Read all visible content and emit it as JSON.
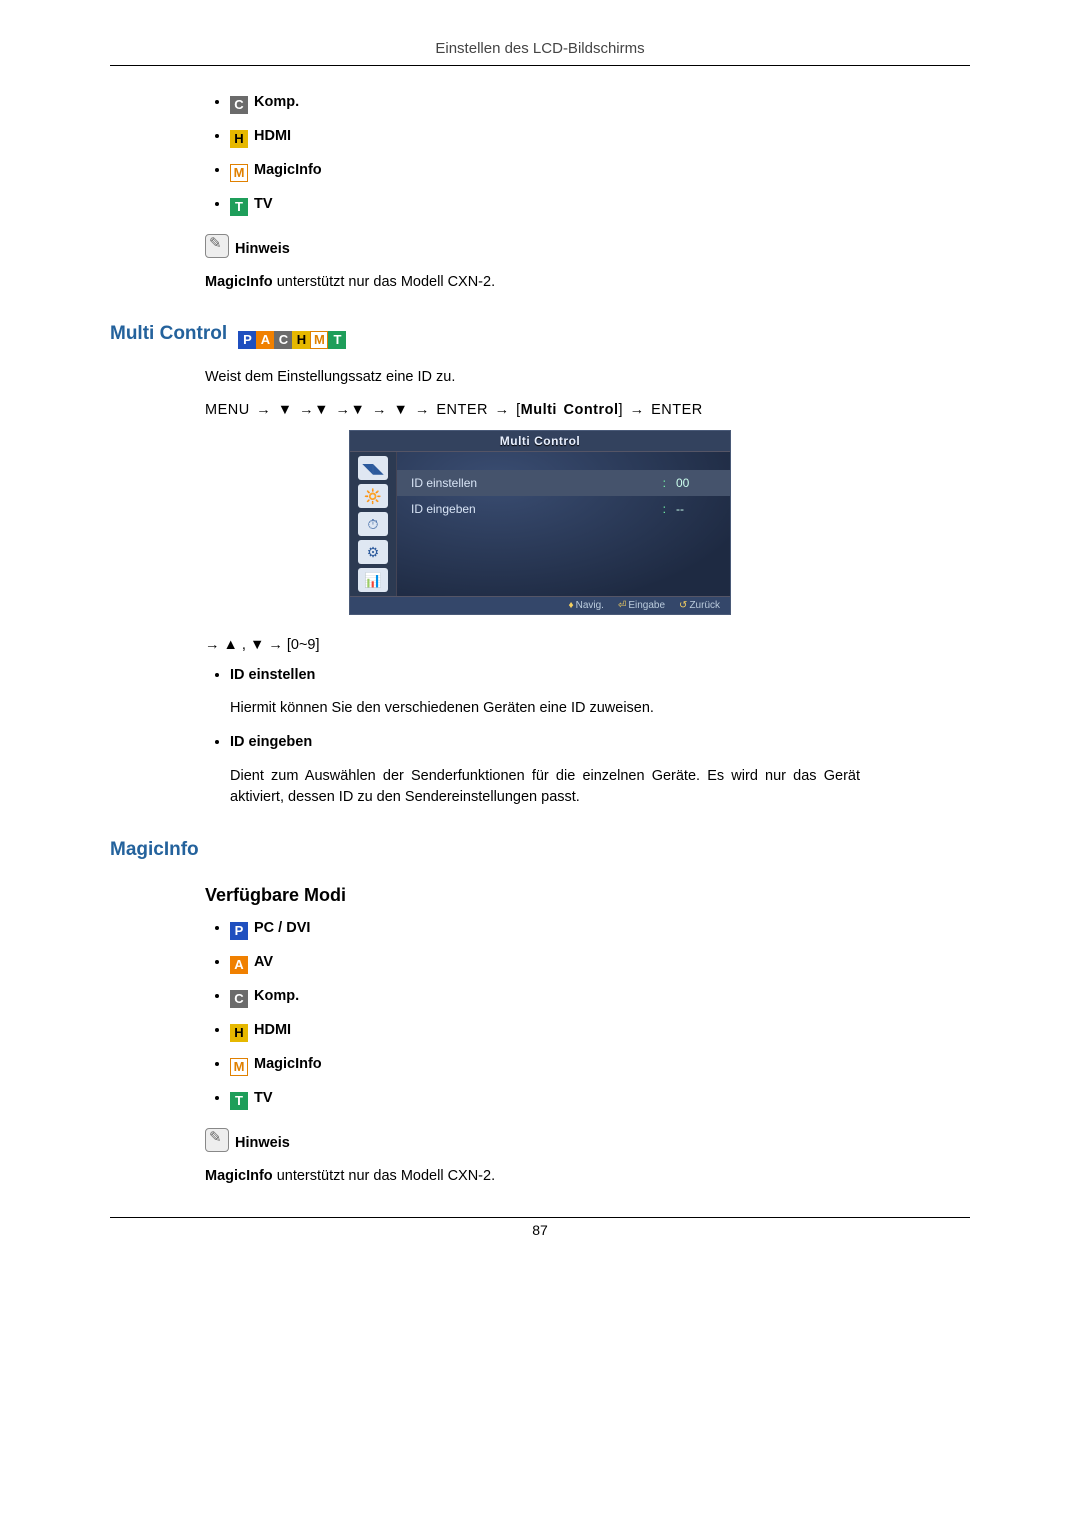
{
  "header": "Einstellen des LCD-Bildschirms",
  "modes_top": {
    "items": [
      {
        "badge": "C",
        "cls": "b-c",
        "label": "Komp."
      },
      {
        "badge": "H",
        "cls": "b-h",
        "label": "HDMI"
      },
      {
        "badge": "M",
        "cls": "b-m",
        "label": "MagicInfo"
      },
      {
        "badge": "T",
        "cls": "b-t",
        "label": "TV"
      }
    ]
  },
  "note_label": "Hinweis",
  "note1": {
    "b": "MagicInfo",
    "rest": " unterstützt nur das Modell CXN-2."
  },
  "multi": {
    "title": "Multi Control",
    "strip": [
      {
        "badge": "P",
        "cls": "b-p"
      },
      {
        "badge": "A",
        "cls": "b-a"
      },
      {
        "badge": "C",
        "cls": "b-c"
      },
      {
        "badge": "H",
        "cls": "b-h"
      },
      {
        "badge": "M",
        "cls": "b-m"
      },
      {
        "badge": "T",
        "cls": "b-t"
      }
    ],
    "intro": "Weist dem Einstellungssatz eine ID zu.",
    "path": {
      "p1": "MENU →",
      "dn": "▼",
      "arr": "→",
      "enter": "ENTER",
      "bracket_open": "[",
      "multi": "Multi Control",
      "bracket_close": "]"
    },
    "osd": {
      "title": "Multi Control",
      "row1": {
        "lbl": "ID einstellen",
        "val": "00"
      },
      "row2": {
        "lbl": "ID eingeben",
        "val": "--"
      },
      "foot": {
        "nav": "Navig.",
        "ent": "Eingabe",
        "back": "Zurück"
      }
    },
    "arrows_line": "→ ▲ , ▼ → [0~9]",
    "opt1": {
      "h": "ID einstellen",
      "p": "Hiermit können Sie den verschiedenen Geräten eine ID zuweisen."
    },
    "opt2": {
      "h": "ID eingeben",
      "p": "Dient zum Auswählen der Senderfunktionen für die einzelnen Geräte. Es wird nur das Gerät aktiviert, dessen ID zu den Sendereinstellungen passt."
    }
  },
  "magicinfo": {
    "title": "MagicInfo",
    "sub": "Verfügbare Modi",
    "items": [
      {
        "badge": "P",
        "cls": "b-p",
        "label": "PC / DVI"
      },
      {
        "badge": "A",
        "cls": "b-a",
        "label": "AV"
      },
      {
        "badge": "C",
        "cls": "b-c",
        "label": "Komp."
      },
      {
        "badge": "H",
        "cls": "b-h",
        "label": "HDMI"
      },
      {
        "badge": "M",
        "cls": "b-m",
        "label": "MagicInfo"
      },
      {
        "badge": "T",
        "cls": "b-t",
        "label": "TV"
      }
    ]
  },
  "note2": {
    "b": "MagicInfo",
    "rest": " unterstützt nur das Modell CXN-2."
  },
  "pagenum": "87"
}
